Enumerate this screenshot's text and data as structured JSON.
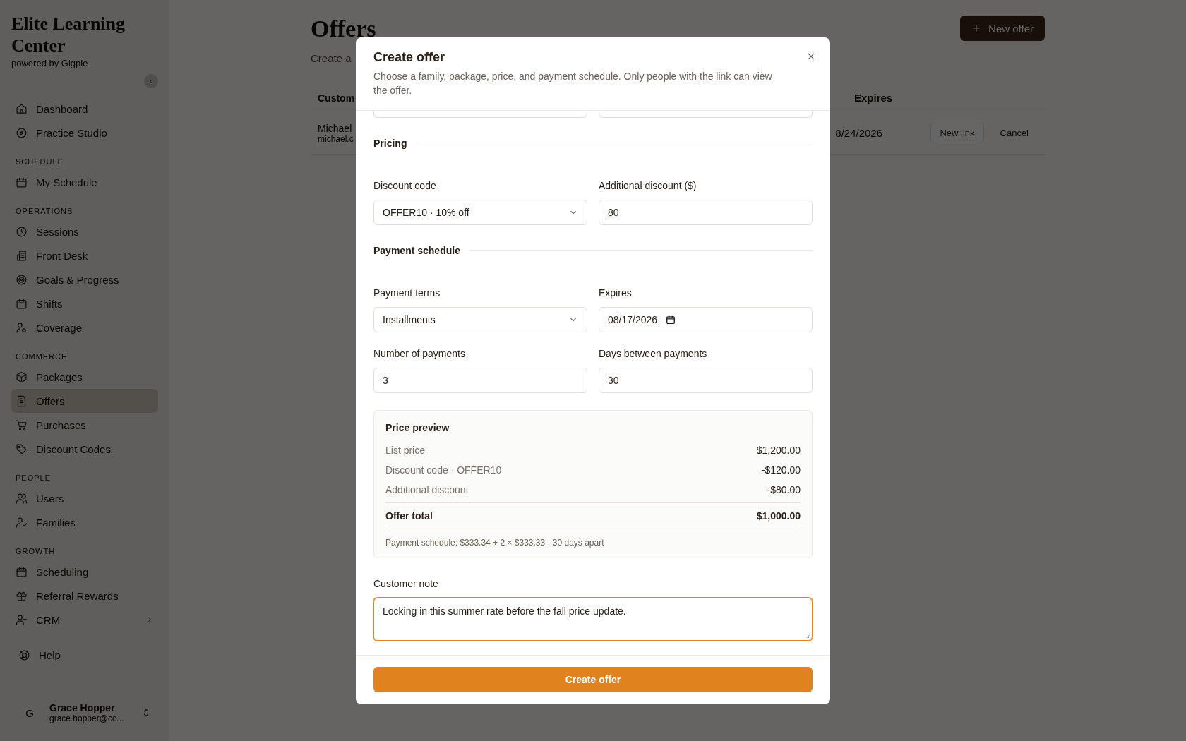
{
  "sidebar": {
    "brand": "Elite Learning Center",
    "tagline": "powered by Gigpie",
    "sections": [
      {
        "items": [
          {
            "label": "Dashboard",
            "selected": false,
            "expandable": false
          },
          {
            "label": "Practice Studio",
            "selected": false,
            "expandable": false
          }
        ]
      },
      {
        "heading": "SCHEDULE",
        "items": [
          {
            "label": "My Schedule",
            "selected": false,
            "expandable": false
          }
        ]
      },
      {
        "heading": "OPERATIONS",
        "items": [
          {
            "label": "Sessions",
            "selected": false,
            "expandable": false
          },
          {
            "label": "Front Desk",
            "selected": false,
            "expandable": false
          },
          {
            "label": "Goals & Progress",
            "selected": false,
            "expandable": false
          },
          {
            "label": "Shifts",
            "selected": false,
            "expandable": false
          },
          {
            "label": "Coverage",
            "selected": false,
            "expandable": false
          }
        ]
      },
      {
        "heading": "COMMERCE",
        "items": [
          {
            "label": "Packages",
            "selected": false,
            "expandable": false
          },
          {
            "label": "Offers",
            "selected": true,
            "expandable": false
          },
          {
            "label": "Purchases",
            "selected": false,
            "expandable": false
          },
          {
            "label": "Discount Codes",
            "selected": false,
            "expandable": false
          }
        ]
      },
      {
        "heading": "PEOPLE",
        "items": [
          {
            "label": "Users",
            "selected": false,
            "expandable": false
          },
          {
            "label": "Families",
            "selected": false,
            "expandable": false
          }
        ]
      },
      {
        "heading": "GROWTH",
        "items": [
          {
            "label": "Scheduling",
            "selected": false,
            "expandable": false
          },
          {
            "label": "Referral Rewards",
            "selected": false,
            "expandable": false
          },
          {
            "label": "CRM",
            "selected": false,
            "expandable": true
          }
        ]
      }
    ],
    "help": "Help",
    "user": {
      "initial": "G",
      "name": "Grace Hopper",
      "email": "grace.hopper@co..."
    }
  },
  "page": {
    "title": "Offers",
    "subtitle": "Create a",
    "new_offer": "New offer",
    "table": {
      "columns": [
        "Custom",
        "Expires"
      ],
      "rows": [
        {
          "customer": "Michael",
          "email": "michael.c",
          "expires": "8/24/2026",
          "actions": [
            "New link",
            "Cancel"
          ]
        }
      ]
    }
  },
  "modal": {
    "title": "Create offer",
    "description": "Choose a family, package, price, and payment schedule. Only people with the link can view the offer.",
    "sections": [
      {
        "heading": "Pricing",
        "rows": [
          [
            {
              "kind": "select",
              "label": "Discount code",
              "value": "OFFER10 · 10% off"
            },
            {
              "kind": "text",
              "label": "Additional discount ($)",
              "value": "80"
            }
          ]
        ]
      },
      {
        "heading": "Payment schedule",
        "rows": [
          [
            {
              "kind": "select",
              "label": "Payment terms",
              "value": "Installments"
            },
            {
              "kind": "date",
              "label": "Expires",
              "value": "08/17/2026"
            }
          ],
          [
            {
              "kind": "text",
              "label": "Number of payments",
              "value": "3"
            },
            {
              "kind": "text",
              "label": "Days between payments",
              "value": "30"
            }
          ]
        ]
      }
    ],
    "preview": {
      "title": "Price preview",
      "lines": [
        {
          "label": "List price",
          "amount": "$1,200.00"
        },
        {
          "label": "Discount code · OFFER10",
          "amount": "-$120.00"
        },
        {
          "label": "Additional discount",
          "amount": "-$80.00"
        }
      ],
      "total": {
        "label": "Offer total",
        "amount": "$1,000.00"
      },
      "schedule": "Payment schedule: $333.34 + 2 × $333.33 · 30 days apart"
    },
    "note": {
      "label": "Customer note",
      "value": "Locking in this summer rate before the fall price update.",
      "focused": true
    },
    "submit": "Create offer"
  }
}
